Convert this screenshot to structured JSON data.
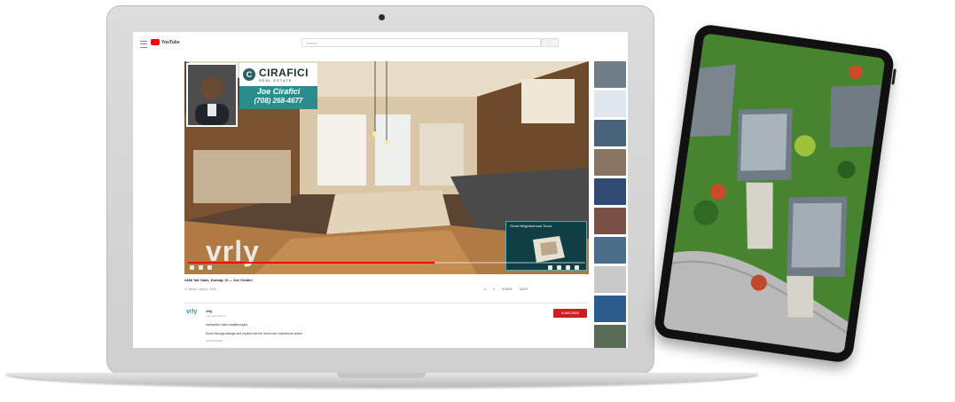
{
  "youtube": {
    "search_placeholder": "Search",
    "logo_text": "YouTube"
  },
  "video": {
    "title": "2458 Tall Oaks, Dunlap, Ill — Joe Cirafici",
    "meta": "17 views • May 8, 2020",
    "watermark": "vrly",
    "pip_title": "Great Neighborhood Tours"
  },
  "agent": {
    "brand_mark": "C",
    "brand_name": "CIRAFICI",
    "brand_sub": "REAL ESTATE",
    "name": "Joe Cirafici",
    "phone": "(708) 268-4677"
  },
  "actions": {
    "like": "4",
    "dislike": "0",
    "share": "SHARE",
    "save": "SAVE"
  },
  "channel": {
    "avatar": "vrly",
    "name": "Vrly",
    "subs": "1.1K subscribers",
    "subscribe_label": "SUBSCRIBE",
    "desc_line1": "Interactive video walkthroughs",
    "desc_line2": "Scroll through listings and explore the full home tour experience online",
    "desc_line3": "SHOW MORE"
  },
  "colors": {
    "brand_teal": "#2a8c8c",
    "youtube_red": "#ff0000",
    "subscribe_red": "#cc1f1f"
  },
  "video_progress_fraction": 0.62
}
